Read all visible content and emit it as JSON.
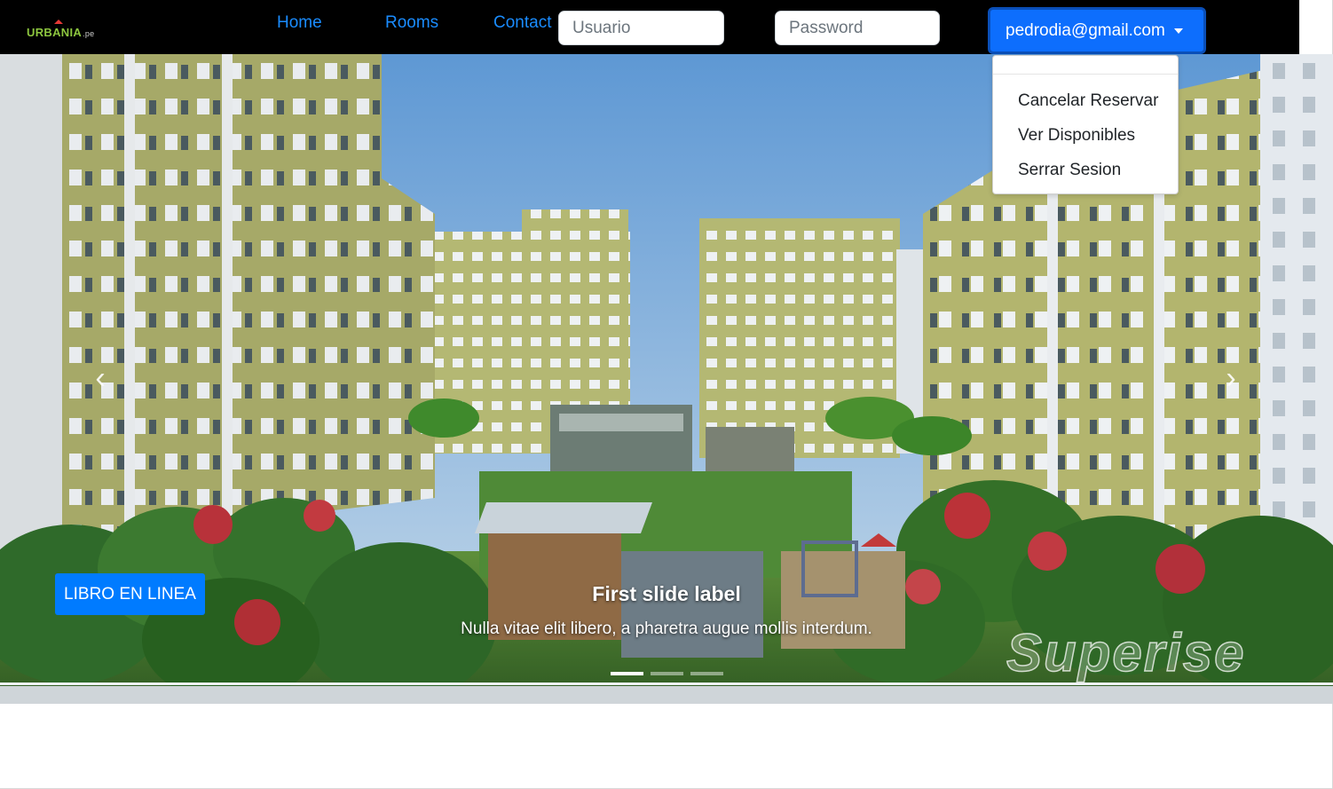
{
  "brand": {
    "name": "URBANIA",
    "suffix": ".pe"
  },
  "nav": {
    "home": "Home",
    "rooms": "Rooms",
    "contact": "Contact"
  },
  "login": {
    "user_placeholder": "Usuario",
    "password_placeholder": "Password"
  },
  "user_menu": {
    "email": "pedrodia@gmail.com",
    "items": [
      "Cancelar Reservar",
      "Ver Disponibles",
      "Serrar Sesion"
    ]
  },
  "hero": {
    "book_button": "LIBRO EN LINEA",
    "caption_title": "First slide label",
    "caption_text": "Nulla vitae elit libero, a pharetra augue mollis interdum.",
    "watermark": "Superise",
    "slide_count": 3,
    "active_slide": 1
  },
  "colors": {
    "navbar_bg": "#000000",
    "nav_link": "#1a8cff",
    "primary": "#007bff",
    "brand_green": "#8dc63f"
  },
  "icons": {
    "prev": "chevron-left-icon",
    "next": "chevron-right-icon",
    "caret": "caret-down-icon"
  }
}
